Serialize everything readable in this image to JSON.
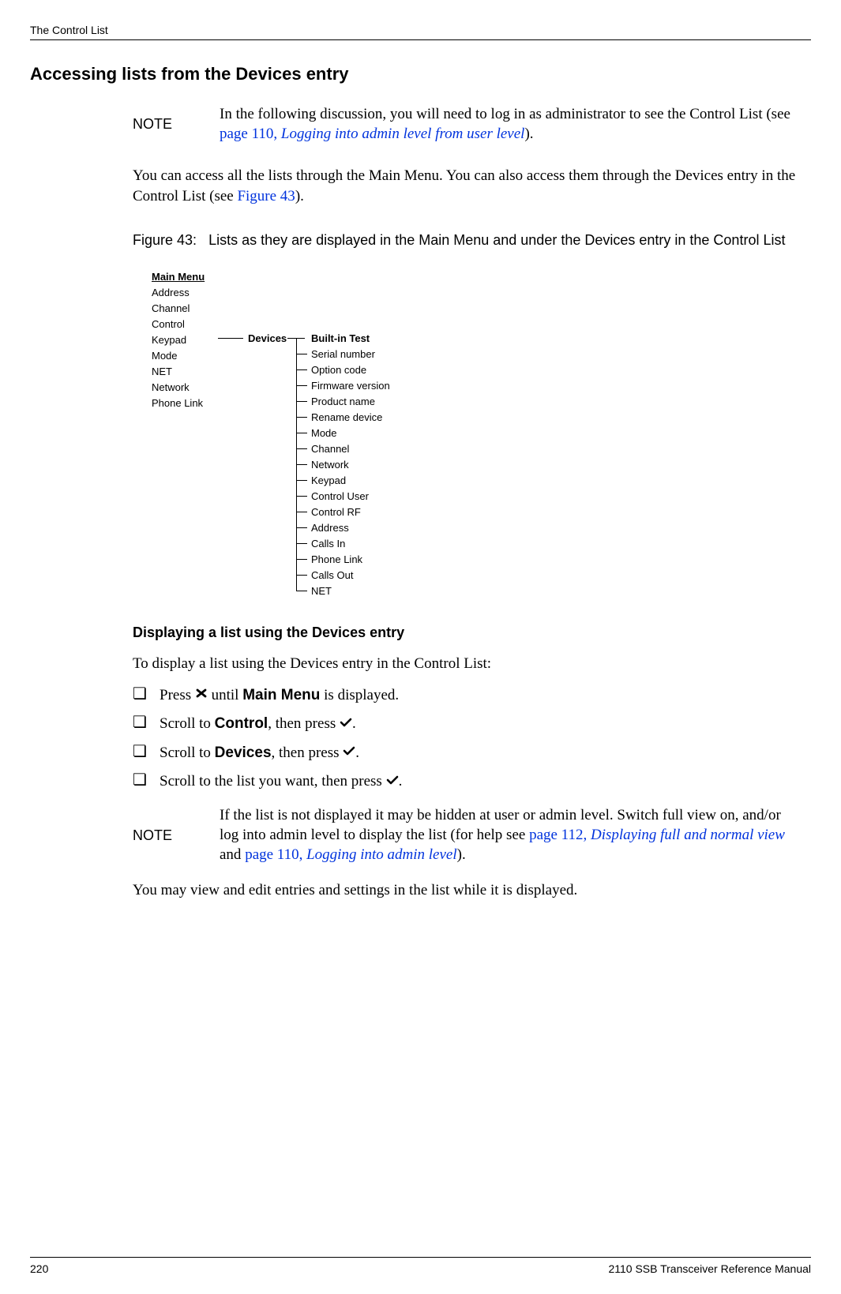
{
  "header": {
    "section": "The Control List"
  },
  "title": "Accessing lists from the Devices entry",
  "note1": {
    "label": "NOTE",
    "text_a": "In the following discussion, you will need to log in as administrator to see the Control List (see ",
    "link_pg": "page 110, ",
    "link_title": "Logging into admin level from user level",
    "text_b": ")."
  },
  "intro": {
    "text_a": "You can access all the lists through the Main Menu. You can also access them through the Devices entry in the Control List (see ",
    "link": "Figure 43",
    "text_b": ")."
  },
  "figure": {
    "prefix": "Figure 43:",
    "caption": "Lists as they are displayed in the Main Menu and under the Devices entry in the Control List"
  },
  "tree": {
    "main_menu": "Main Menu",
    "items": [
      "Address",
      "Channel",
      "Control",
      "Keypad",
      "Mode",
      "NET",
      "Network",
      "Phone Link"
    ],
    "devices_label": "Devices",
    "devices_first": "Built-in Test",
    "devices_items": [
      "Serial number",
      "Option code",
      "Firmware version",
      "Product name",
      "Rename device",
      "Mode",
      "Channel",
      "Network",
      "Keypad",
      "Control User",
      "Control RF",
      "Address",
      "Calls In",
      "Phone Link",
      "Calls Out",
      "NET"
    ]
  },
  "section2": {
    "heading": "Displaying a list using the Devices entry",
    "intro": "To display a list using the Devices entry in the Control List:",
    "steps": [
      {
        "a": "Press ",
        "icon": "x",
        "b": " until ",
        "bold": "Main Menu",
        "c": " is displayed."
      },
      {
        "a": "Scroll to ",
        "bold": "Control",
        "b": ", then press ",
        "icon": "check",
        "c": "."
      },
      {
        "a": "Scroll to ",
        "bold": "Devices",
        "b": ", then press ",
        "icon": "check",
        "c": "."
      },
      {
        "a": "Scroll to the list you want, then press ",
        "icon": "check",
        "b": ".",
        "bold": "",
        "c": ""
      }
    ]
  },
  "note2": {
    "label": "NOTE",
    "text_a": "If the list is not displayed it may be hidden at user or admin level. Switch full view on, and/or log into admin level to display the list (for help see ",
    "link1_pg": "page 112, ",
    "link1_title": "Displaying full and normal view",
    "mid": " and ",
    "link2_pg": "page 110, ",
    "link2_title": "Logging into admin level",
    "text_b": ")."
  },
  "closing": "You may view and edit entries and settings in the list while it is displayed.",
  "footer": {
    "page": "220",
    "doc": "2110 SSB Transceiver Reference Manual"
  }
}
